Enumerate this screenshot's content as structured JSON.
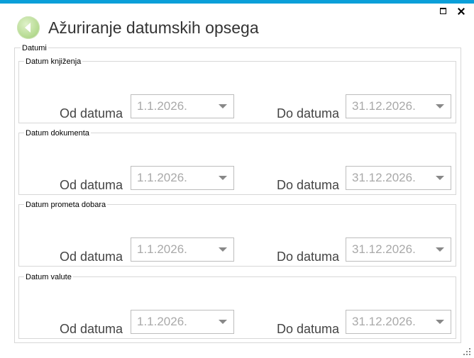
{
  "window": {
    "title": "Ažuriranje datumskih opsega",
    "maximize_icon": "maximize-icon",
    "close_icon": "close-icon",
    "back_icon": "back-arrow-icon",
    "accent_color": "#0a9fd9"
  },
  "outer_group": {
    "legend": "Datumi"
  },
  "groups": [
    {
      "legend": "Datum knjiženja",
      "from_label": "Od datuma",
      "from_value": "1.1.2026.",
      "to_label": "Do datuma",
      "to_value": "31.12.2026."
    },
    {
      "legend": "Datum dokumenta",
      "from_label": "Od datuma",
      "from_value": "1.1.2026.",
      "to_label": "Do datuma",
      "to_value": "31.12.2026."
    },
    {
      "legend": "Datum prometa dobara",
      "from_label": "Od datuma",
      "from_value": "1.1.2026.",
      "to_label": "Do datuma",
      "to_value": "31.12.2026."
    },
    {
      "legend": "Datum valute",
      "from_label": "Od datuma",
      "from_value": "1.1.2026.",
      "to_label": "Do datuma",
      "to_value": "31.12.2026."
    }
  ]
}
